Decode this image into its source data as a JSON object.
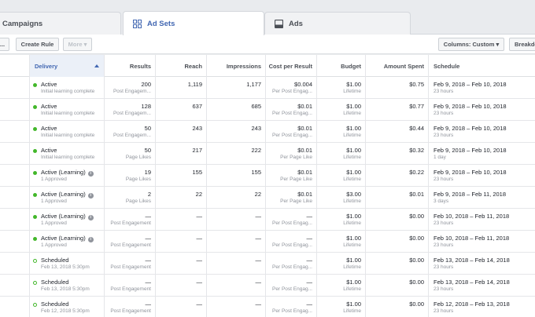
{
  "tabs": [
    {
      "label": "Campaigns",
      "icon": "folder-icon"
    },
    {
      "label": "Ad Sets",
      "icon": "grid-icon",
      "active": true
    },
    {
      "label": "Ads",
      "icon": "ad-icon"
    }
  ],
  "toolbar": {
    "more_left": "...",
    "create_rule": "Create Rule",
    "more": "More ▾",
    "columns": "Columns: Custom ▾",
    "breakdown": "Breakdown"
  },
  "columns": {
    "delivery": "Delivery",
    "results": "Results",
    "reach": "Reach",
    "impressions": "Impressions",
    "cost_per_result": "Cost per Result",
    "budget": "Budget",
    "amount_spent": "Amount Spent",
    "schedule": "Schedule"
  },
  "rows": [
    {
      "status": "Active",
      "sub": "Initial learning complete",
      "dot": "filled",
      "info": false,
      "results": "200",
      "results_sub": "Post Engagem...",
      "reach": "1,119",
      "impressions": "1,177",
      "cost": "$0.004",
      "cost_sub": "Per Post Engag...",
      "budget": "$1.00",
      "budget_sub": "Lifetime",
      "spent": "$0.75",
      "schedule": "Feb 9, 2018 – Feb 10, 2018",
      "schedule_sub": "23 hours"
    },
    {
      "status": "Active",
      "sub": "Initial learning complete",
      "dot": "filled",
      "info": false,
      "results": "128",
      "results_sub": "Post Engagem...",
      "reach": "637",
      "impressions": "685",
      "cost": "$0.01",
      "cost_sub": "Per Post Engag...",
      "budget": "$1.00",
      "budget_sub": "Lifetime",
      "spent": "$0.77",
      "schedule": "Feb 9, 2018 – Feb 10, 2018",
      "schedule_sub": "23 hours"
    },
    {
      "status": "Active",
      "sub": "Initial learning complete",
      "dot": "filled",
      "info": false,
      "results": "50",
      "results_sub": "Post Engagem...",
      "reach": "243",
      "impressions": "243",
      "cost": "$0.01",
      "cost_sub": "Per Post Engag...",
      "budget": "$1.00",
      "budget_sub": "Lifetime",
      "spent": "$0.44",
      "schedule": "Feb 9, 2018 – Feb 10, 2018",
      "schedule_sub": "23 hours"
    },
    {
      "status": "Active",
      "sub": "Initial learning complete",
      "dot": "filled",
      "info": false,
      "results": "50",
      "results_sub": "Page Likes",
      "reach": "217",
      "impressions": "222",
      "cost": "$0.01",
      "cost_sub": "Per Page Like",
      "budget": "$1.00",
      "budget_sub": "Lifetime",
      "spent": "$0.32",
      "schedule": "Feb 9, 2018 – Feb 10, 2018",
      "schedule_sub": "1 day"
    },
    {
      "status": "Active (Learning)",
      "sub": "1 Approved",
      "dot": "filled",
      "info": true,
      "results": "19",
      "results_sub": "Page Likes",
      "reach": "155",
      "impressions": "155",
      "cost": "$0.01",
      "cost_sub": "Per Page Like",
      "budget": "$1.00",
      "budget_sub": "Lifetime",
      "spent": "$0.22",
      "schedule": "Feb 9, 2018 – Feb 10, 2018",
      "schedule_sub": "23 hours"
    },
    {
      "status": "Active (Learning)",
      "sub": "1 Approved",
      "dot": "filled",
      "info": true,
      "results": "2",
      "results_sub": "Page Likes",
      "reach": "22",
      "impressions": "22",
      "cost": "$0.01",
      "cost_sub": "Per Page Like",
      "budget": "$3.00",
      "budget_sub": "Lifetime",
      "spent": "$0.01",
      "schedule": "Feb 9, 2018 – Feb 11, 2018",
      "schedule_sub": "3 days"
    },
    {
      "status": "Active (Learning)",
      "sub": "1 Approved",
      "dot": "filled",
      "info": true,
      "results": "—",
      "results_sub": "Post Engagement",
      "reach": "—",
      "impressions": "—",
      "cost": "—",
      "cost_sub": "Per Post Engag...",
      "budget": "$1.00",
      "budget_sub": "Lifetime",
      "spent": "$0.00",
      "schedule": "Feb 10, 2018 – Feb 11, 2018",
      "schedule_sub": "23 hours"
    },
    {
      "status": "Active (Learning)",
      "sub": "1 Approved",
      "dot": "filled",
      "info": true,
      "results": "—",
      "results_sub": "Post Engagement",
      "reach": "—",
      "impressions": "—",
      "cost": "—",
      "cost_sub": "Per Post Engag...",
      "budget": "$1.00",
      "budget_sub": "Lifetime",
      "spent": "$0.00",
      "schedule": "Feb 10, 2018 – Feb 11, 2018",
      "schedule_sub": "23 hours"
    },
    {
      "status": "Scheduled",
      "sub": "Feb 13, 2018 5:30pm",
      "dot": "hollow",
      "info": false,
      "results": "—",
      "results_sub": "Post Engagement",
      "reach": "—",
      "impressions": "—",
      "cost": "—",
      "cost_sub": "Per Post Engag...",
      "budget": "$1.00",
      "budget_sub": "Lifetime",
      "spent": "$0.00",
      "schedule": "Feb 13, 2018 – Feb 14, 2018",
      "schedule_sub": "23 hours"
    },
    {
      "status": "Scheduled",
      "sub": "Feb 13, 2018 5:30pm",
      "dot": "hollow",
      "info": false,
      "results": "—",
      "results_sub": "Post Engagement",
      "reach": "—",
      "impressions": "—",
      "cost": "—",
      "cost_sub": "Per Post Engag...",
      "budget": "$1.00",
      "budget_sub": "Lifetime",
      "spent": "$0.00",
      "schedule": "Feb 13, 2018 – Feb 14, 2018",
      "schedule_sub": "23 hours"
    },
    {
      "status": "Scheduled",
      "sub": "Feb 12, 2018 5:30pm",
      "dot": "hollow",
      "info": false,
      "results": "—",
      "results_sub": "Post Engagement",
      "reach": "—",
      "impressions": "—",
      "cost": "—",
      "cost_sub": "Per Post Engag...",
      "budget": "$1.00",
      "budget_sub": "Lifetime",
      "spent": "$0.00",
      "schedule": "Feb 12, 2018 – Feb 13, 2018",
      "schedule_sub": "23 hours"
    }
  ]
}
